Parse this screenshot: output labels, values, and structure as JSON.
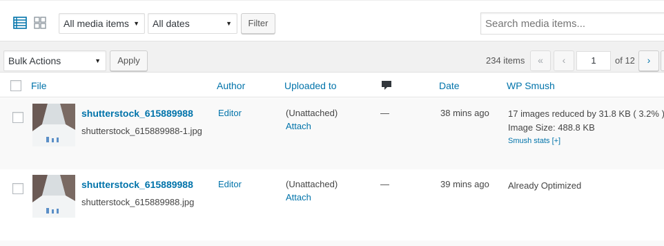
{
  "toolbar": {
    "view_list_icon": "list-view-icon",
    "view_grid_icon": "grid-view-icon",
    "media_filter": "All media items",
    "date_filter": "All dates",
    "filter_label": "Filter",
    "search_placeholder": "Search media items..."
  },
  "bulk": {
    "action": "Bulk Actions",
    "apply_label": "Apply"
  },
  "pagination": {
    "count": "234 items",
    "first": "«",
    "prev": "‹",
    "current_page": "1",
    "of_total": "of 12",
    "next": "›"
  },
  "columns": {
    "file": "File",
    "author": "Author",
    "uploaded_to": "Uploaded to",
    "comments_icon": "comment-bubble-icon",
    "date": "Date",
    "wp_smush": "WP Smush"
  },
  "rows": [
    {
      "title": "shutterstock_615889988",
      "filename": "shutterstock_615889988-1.jpg",
      "author": "Editor",
      "uploaded_to": "(Unattached)",
      "attach": "Attach",
      "comments": "—",
      "date": "38 mins ago",
      "smush_line1": "17 images reduced by 31.8 KB ( 3.2% )",
      "smush_line2": "Image Size: 488.8 KB",
      "smush_stats": "Smush stats [+]"
    },
    {
      "title": "shutterstock_615889988",
      "filename": "shutterstock_615889988.jpg",
      "author": "Editor",
      "uploaded_to": "(Unattached)",
      "attach": "Attach",
      "comments": "—",
      "date": "39 mins ago",
      "smush_line1": "Already Optimized"
    }
  ],
  "colors": {
    "link": "#0073aa",
    "text": "#444444",
    "row_alt": "#f9f9f9"
  }
}
